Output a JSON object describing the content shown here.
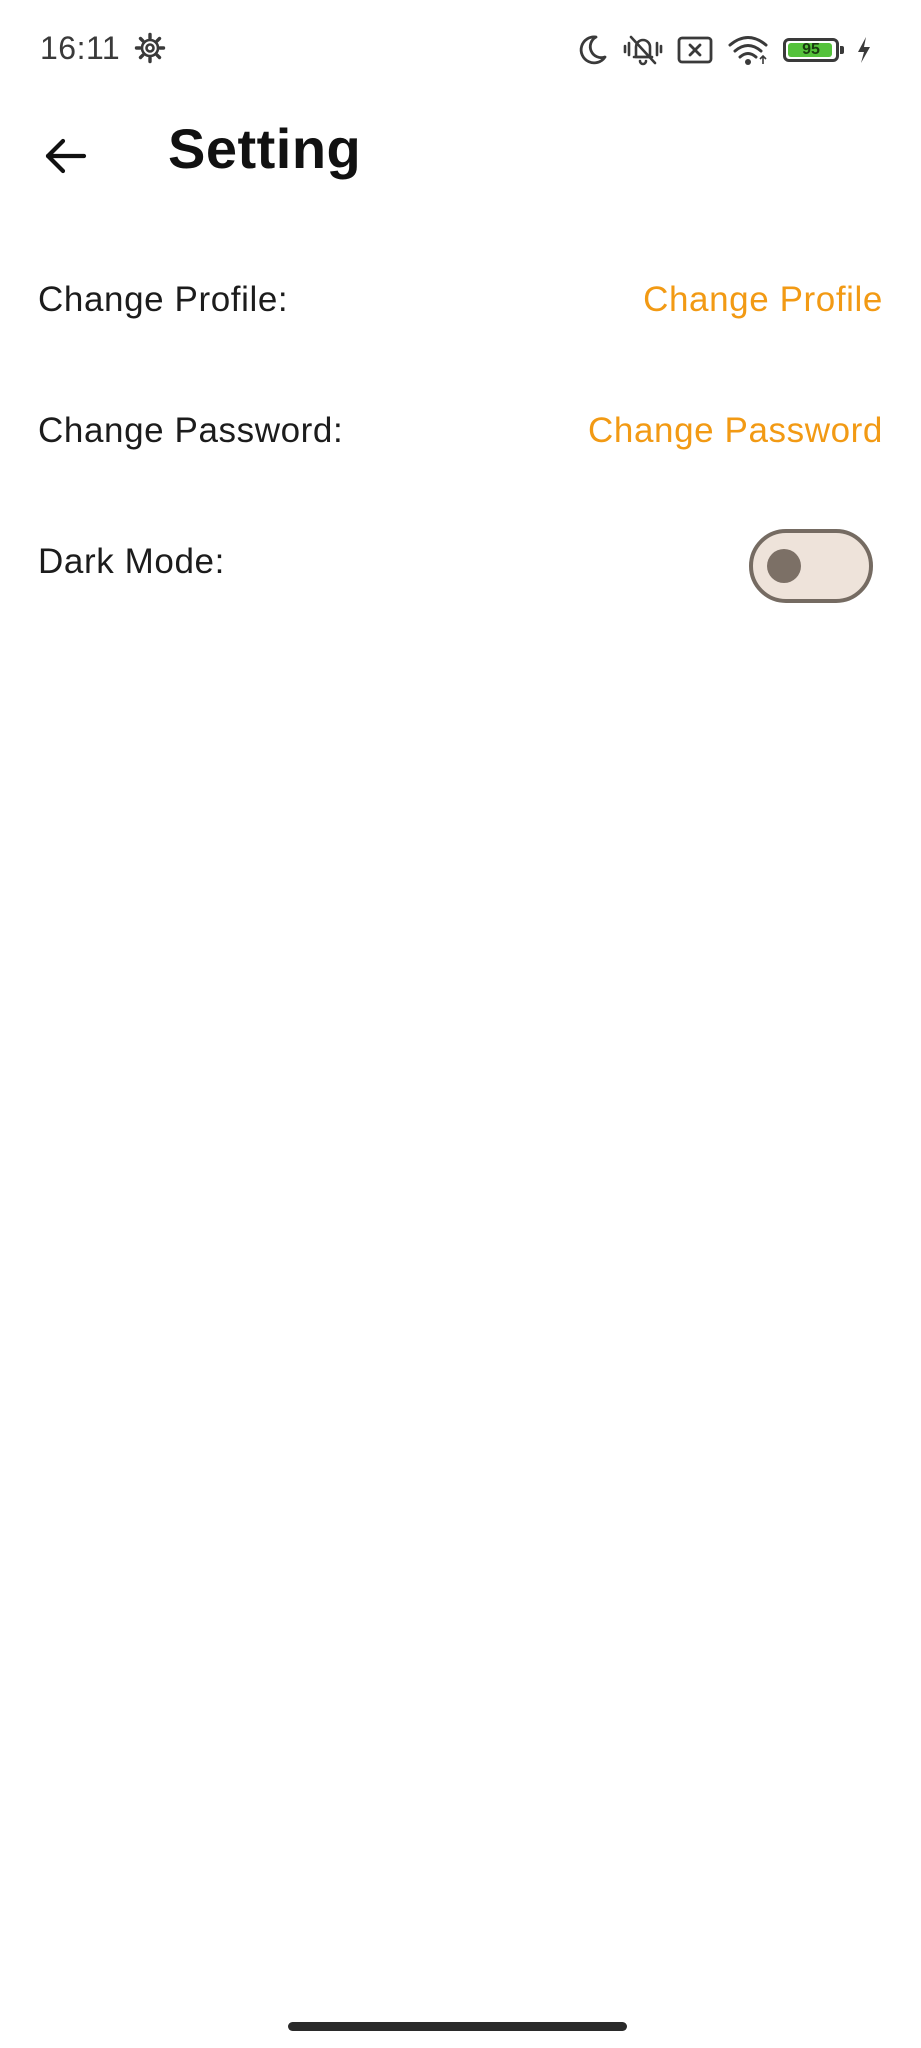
{
  "status_bar": {
    "time": "16:11",
    "battery_level": "95",
    "battery_fraction": 0.95,
    "icons": [
      "gear-icon",
      "moon-icon",
      "vibrate-off-icon",
      "no-sim-icon",
      "wifi-icon",
      "battery-icon",
      "charging-bolt-icon"
    ]
  },
  "app_bar": {
    "title": "Setting",
    "back_icon": "arrow-left-icon"
  },
  "settings": {
    "change_profile": {
      "label": "Change Profile:",
      "action": "Change Profile"
    },
    "change_password": {
      "label": "Change Password:",
      "action": "Change Password"
    },
    "dark_mode": {
      "label": "Dark Mode:",
      "enabled": false
    }
  },
  "colors": {
    "accent": "#f29a14",
    "toggle_track": "#eee3da",
    "toggle_border": "#756b62",
    "toggle_knob": "#7c7066",
    "battery_fill": "#55c23b"
  }
}
